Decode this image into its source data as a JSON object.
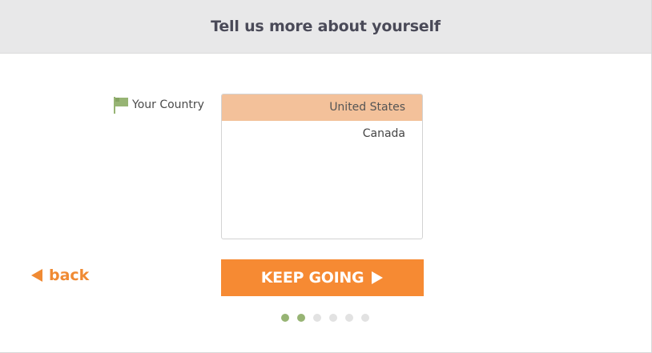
{
  "header": {
    "title": "Tell us more about yourself"
  },
  "country_field": {
    "label": "Your Country",
    "icon": "flag-icon",
    "options": [
      "United States",
      "Canada"
    ],
    "selected": "United States",
    "selected_color": "#f3c19a"
  },
  "navigation": {
    "back_label": "back",
    "back_icon": "triangle-left-icon",
    "continue_label": "KEEP GOING",
    "continue_icon": "play-icon",
    "accent_color": "#f68a33"
  },
  "progress": {
    "current_step": 2,
    "total_steps": 6,
    "completed_color": "#97b474",
    "pending_color": "#e2e2e2"
  }
}
